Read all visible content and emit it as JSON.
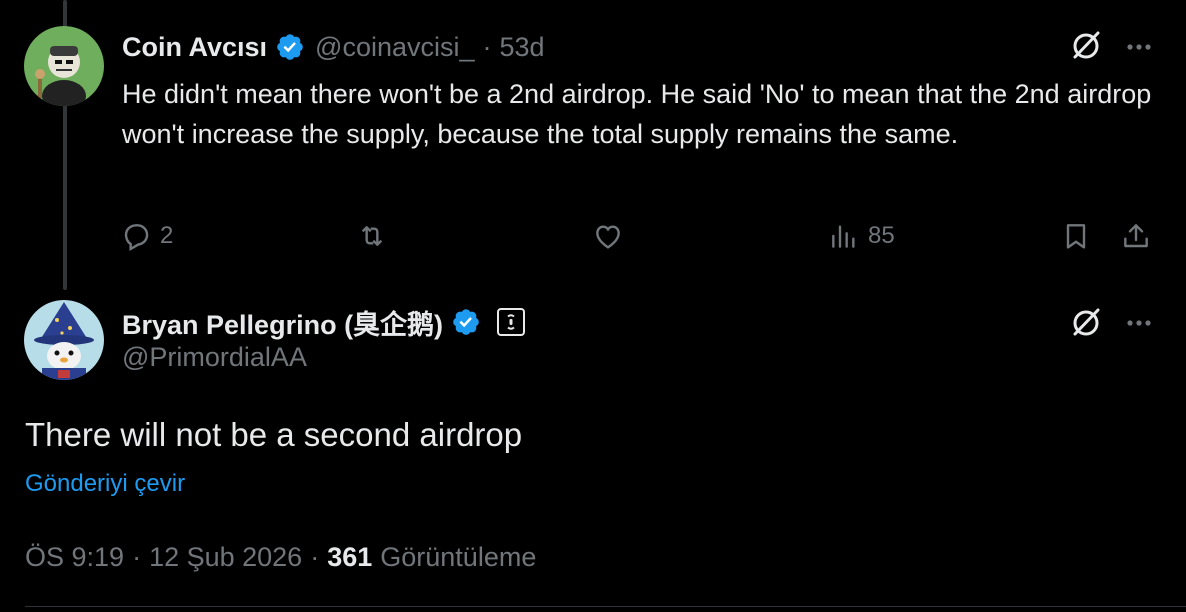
{
  "reply_tweet": {
    "author_name": "Coin Avcısı",
    "handle": "@coinavcisi_",
    "separator": "·",
    "age": "53d",
    "text": "He didn't mean there won't be a 2nd airdrop. He said 'No' to mean that the 2nd airdrop won't increase the supply, because the total supply remains the same.",
    "actions": {
      "reply_count": "2",
      "views_count": "85"
    },
    "icons": [
      "verified-badge-icon",
      "grok-icon",
      "more-icon",
      "reply-icon",
      "retweet-icon",
      "like-icon",
      "views-icon",
      "bookmark-icon",
      "share-icon"
    ]
  },
  "main_tweet": {
    "author_name": "Bryan Pellegrino (臭企鹅)",
    "handle": "@PrimordialAA",
    "text": "There will not be a second airdrop",
    "translate_link": "Gönderiyi çevir",
    "time": "ÖS 9:19",
    "separator1": "·",
    "date": "12 Şub 2026",
    "separator2": "·",
    "views_count": "361",
    "views_label": "Görüntüleme",
    "icons": [
      "verified-badge-icon",
      "affiliate-badge-icon",
      "grok-icon",
      "more-icon"
    ]
  },
  "colors": {
    "background": "#000000",
    "text_primary": "#e7e9ea",
    "text_secondary": "#71767b",
    "accent_blue": "#1d9bf0",
    "verified_blue": "#1d9bf0"
  }
}
